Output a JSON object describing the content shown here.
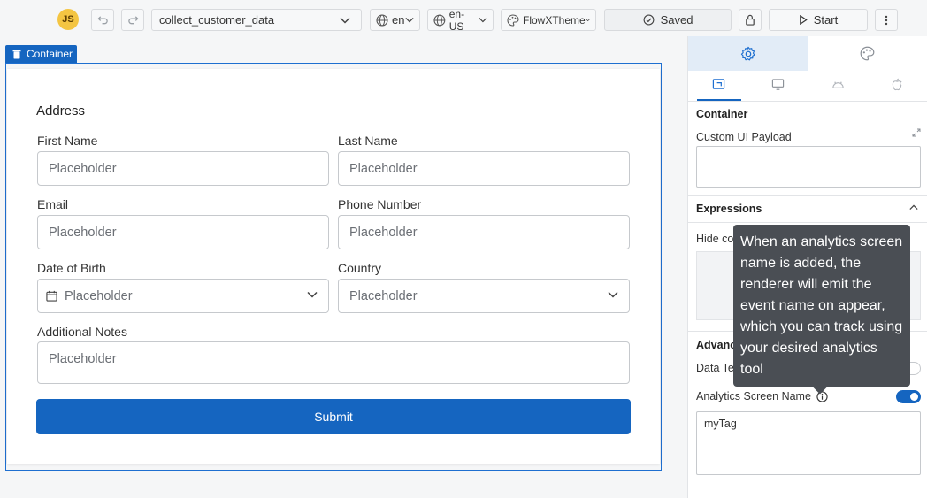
{
  "header": {
    "avatar_initials": "JS",
    "flow_name": "collect_customer_data",
    "language": "en",
    "locale": "en-US",
    "theme": "FlowXTheme",
    "save_status": "Saved",
    "start_label": "Start"
  },
  "canvas": {
    "container_label": "Container",
    "form_title": "Address",
    "fields": {
      "first_name": {
        "label": "First Name",
        "placeholder": "Placeholder"
      },
      "last_name": {
        "label": "Last Name",
        "placeholder": "Placeholder"
      },
      "email": {
        "label": "Email",
        "placeholder": "Placeholder"
      },
      "phone": {
        "label": "Phone Number",
        "placeholder": "Placeholder"
      },
      "dob": {
        "label": "Date of Birth",
        "placeholder": "Placeholder"
      },
      "country": {
        "label": "Country",
        "placeholder": "Placeholder"
      },
      "notes": {
        "label": "Additional Notes",
        "placeholder": "Placeholder"
      }
    },
    "submit_label": "Submit"
  },
  "panel": {
    "section_container": "Container",
    "custom_payload_label": "Custom UI Payload",
    "custom_payload_value": "-",
    "section_expressions": "Expressions",
    "hide_label": "Hide co",
    "section_advanced": "Advanc",
    "data_test_label": "Data Te",
    "analytics_label": "Analytics Screen Name",
    "analytics_value": "myTag",
    "analytics_enabled": true,
    "tooltip": "When an analytics screen name is added, the renderer will emit the event name on appear, which you can track using your desired analytics tool"
  },
  "colors": {
    "accent": "#1565c0",
    "avatar": "#f4c542",
    "tooltip_bg": "#4a4e54"
  }
}
